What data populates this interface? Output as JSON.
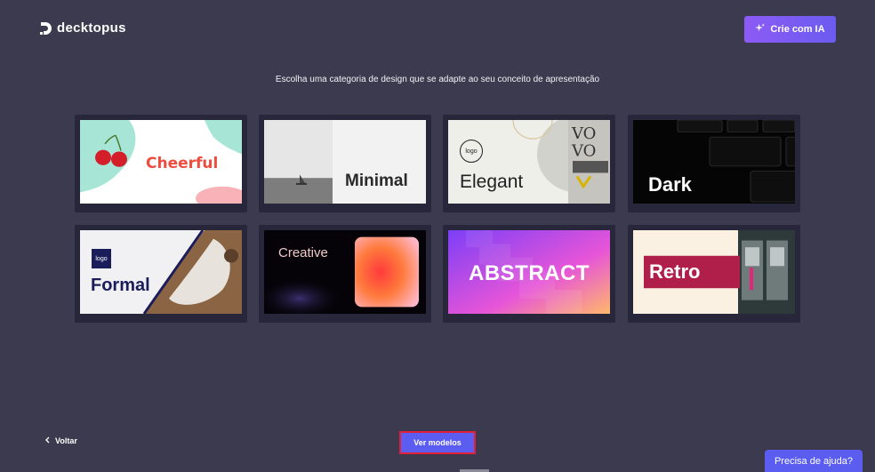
{
  "brand": {
    "name": "decktopus"
  },
  "header": {
    "ai_button_label": "Crie com IA",
    "ai_icon": "sparkles-icon"
  },
  "main": {
    "subtitle": "Escolha uma categoria de design que se adapte ao seu conceito de apresentação",
    "categories": [
      {
        "label": "Cheerful"
      },
      {
        "label": "Minimal"
      },
      {
        "label": "Elegant",
        "badge": "logo"
      },
      {
        "label": "Dark"
      },
      {
        "label": "Formal",
        "badge": "logo"
      },
      {
        "label": "Creative"
      },
      {
        "label": "ABSTRACT"
      },
      {
        "label": "Retro"
      }
    ]
  },
  "footer": {
    "back_label": "Voltar",
    "templates_button": "Ver modelos",
    "help_button": "Precisa de ajuda?"
  },
  "colors": {
    "accent": "#5b5cf0",
    "ai_gradient_start": "#8c5bf5",
    "page_bg": "#3b3a4f",
    "highlight": "#e2203a"
  }
}
